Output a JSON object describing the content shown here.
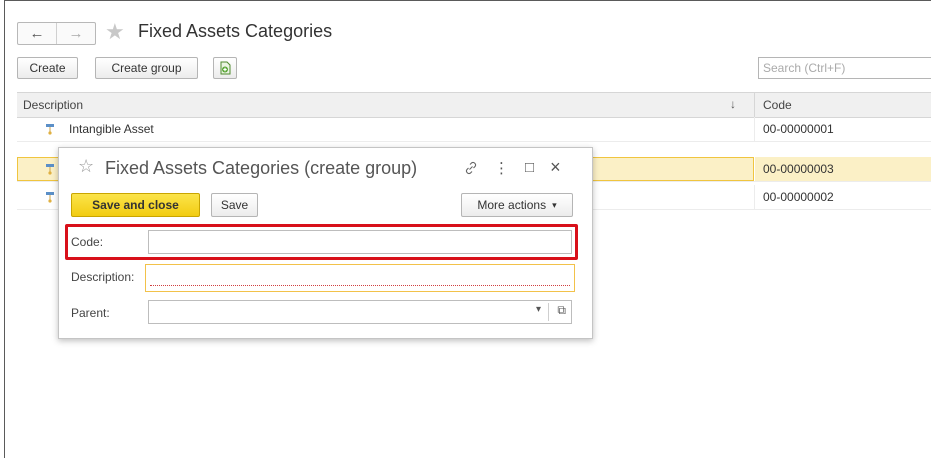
{
  "page": {
    "title": "Fixed Assets Categories",
    "back_glyph": "←",
    "forward_glyph": "→",
    "star_glyph": "★"
  },
  "toolbar": {
    "create_label": "Create",
    "create_group_label": "Create group",
    "search_placeholder": "Search (Ctrl+F)"
  },
  "list": {
    "columns": {
      "description": "Description",
      "sort_glyph": "↓",
      "code": "Code"
    },
    "rows": [
      {
        "description": "Intangible Asset",
        "code": "00-00000001"
      },
      {
        "description": "",
        "code": "00-00000003"
      },
      {
        "description": "",
        "code": "00-00000002"
      }
    ]
  },
  "dialog": {
    "title": "Fixed Assets Categories (create group)",
    "star_glyph": "☆",
    "link_glyph": "🔗",
    "menu_glyph": "⋮",
    "maximize_glyph": "□",
    "close_glyph": "×",
    "save_close_label": "Save and close",
    "save_label": "Save",
    "more_actions_label": "More actions",
    "more_actions_glyph": "▾",
    "fields": {
      "code_label": "Code:",
      "code_value": "",
      "description_label": "Description:",
      "description_value": "",
      "parent_label": "Parent:",
      "parent_value": "",
      "dropdown_glyph": "▾",
      "open_glyph": "⧉"
    }
  },
  "colors": {
    "accent_yellow": "#f2cc12",
    "selection_bg": "#fbf0c6",
    "highlight_red": "#d8101a",
    "group_icon": "#5b8fc7"
  }
}
